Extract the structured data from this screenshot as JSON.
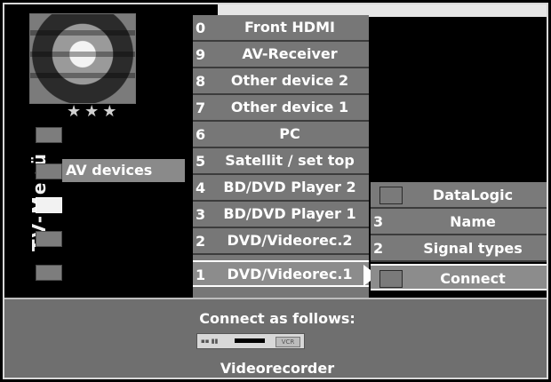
{
  "window": {
    "title": "TV-Menü"
  },
  "left": {
    "rating_stars": "★★★",
    "active_item": "AV devices"
  },
  "middle_list": [
    {
      "num": "0",
      "label": "Front HDMI"
    },
    {
      "num": "9",
      "label": "AV-Receiver"
    },
    {
      "num": "8",
      "label": "Other device 2"
    },
    {
      "num": "7",
      "label": "Other device 1"
    },
    {
      "num": "6",
      "label": "PC"
    },
    {
      "num": "5",
      "label": "Satellit / set top"
    },
    {
      "num": "4",
      "label": "BD/DVD Player 2"
    },
    {
      "num": "3",
      "label": "BD/DVD Player 1"
    },
    {
      "num": "2",
      "label": "DVD/Videorec.2"
    },
    {
      "num": "1",
      "label": "DVD/Videorec.1"
    }
  ],
  "submenu": [
    {
      "num": "",
      "label": "DataLogic"
    },
    {
      "num": "3",
      "label": "Name"
    },
    {
      "num": "2",
      "label": "Signal types"
    },
    {
      "num": "",
      "label": "Connect"
    }
  ],
  "bottom": {
    "connect_text": "Connect as follows:",
    "device_name": "Videorecorder",
    "vcr_badge": "VCR"
  }
}
